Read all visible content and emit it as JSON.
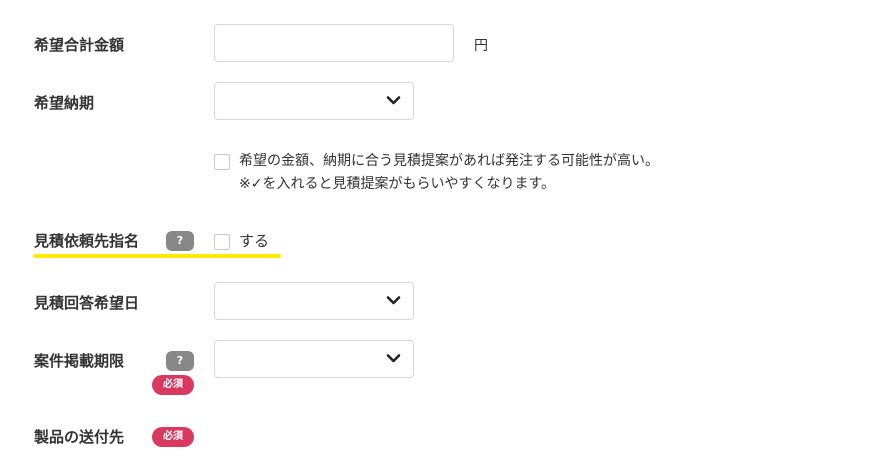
{
  "form": {
    "total_amount": {
      "label": "希望合計金額",
      "value": "",
      "placeholder": "",
      "unit": "円"
    },
    "delivery_date": {
      "label": "希望納期",
      "selected": ""
    },
    "budget_note": {
      "checkbox_text": "希望の金額、納期に合う見積提案があれば発注する可能性が高い。",
      "hint_text": "※✓を入れると見積提案がもらいやすくなります。",
      "checked": false
    },
    "vendor_designation": {
      "label": "見積依頼先指名",
      "help_icon_text": "?",
      "checkbox_text": "する",
      "checked": false
    },
    "reply_date": {
      "label": "見積回答希望日",
      "selected": ""
    },
    "listing_deadline": {
      "label": "案件掲載期限",
      "help_icon_text": "?",
      "required_badge": "必須",
      "selected": ""
    },
    "shipping_destination": {
      "label": "製品の送付先",
      "required_badge": "必須"
    }
  },
  "colors": {
    "required_badge": "#d9395f",
    "help_icon": "#878787",
    "highlight": "#ffea00",
    "border": "#d6d6d6"
  }
}
